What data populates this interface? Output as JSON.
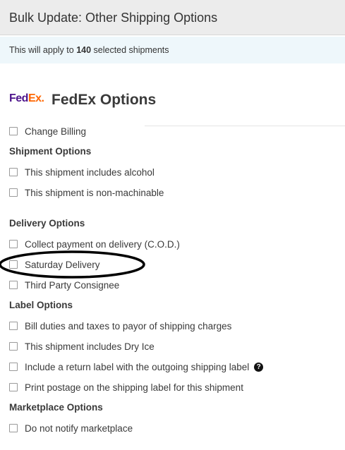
{
  "header": {
    "title": "Bulk Update: Other Shipping Options"
  },
  "info": {
    "prefix": "This will apply to ",
    "count": "140",
    "suffix": " selected shipments"
  },
  "fedex": {
    "logo_fed": "Fed",
    "logo_ex": "Ex",
    "logo_dot": ".",
    "title": "FedEx Options"
  },
  "options": {
    "change_billing": "Change Billing",
    "shipment_options_title": "Shipment Options",
    "alcohol": "This shipment includes alcohol",
    "non_machinable": "This shipment is non-machinable",
    "delivery_options_title": "Delivery Options",
    "cod": "Collect payment on delivery (C.O.D.)",
    "saturday": "Saturday Delivery",
    "third_party": "Third Party Consignee",
    "label_options_title": "Label Options",
    "bill_duties": "Bill duties and taxes to payor of shipping charges",
    "dry_ice": "This shipment includes Dry Ice",
    "return_label": "Include a return label with the outgoing shipping label",
    "help_glyph": "?",
    "print_postage": "Print postage on the shipping label for this shipment",
    "marketplace_options_title": "Marketplace Options",
    "do_not_notify": "Do not notify marketplace"
  },
  "colors": {
    "fedex_purple": "#4d148c",
    "fedex_orange": "#ff6600",
    "info_bar": "#eef7fb",
    "header_bg": "#ececec"
  },
  "icons": {
    "help": "help-circle-icon",
    "annotation": "annotation-ellipse"
  }
}
